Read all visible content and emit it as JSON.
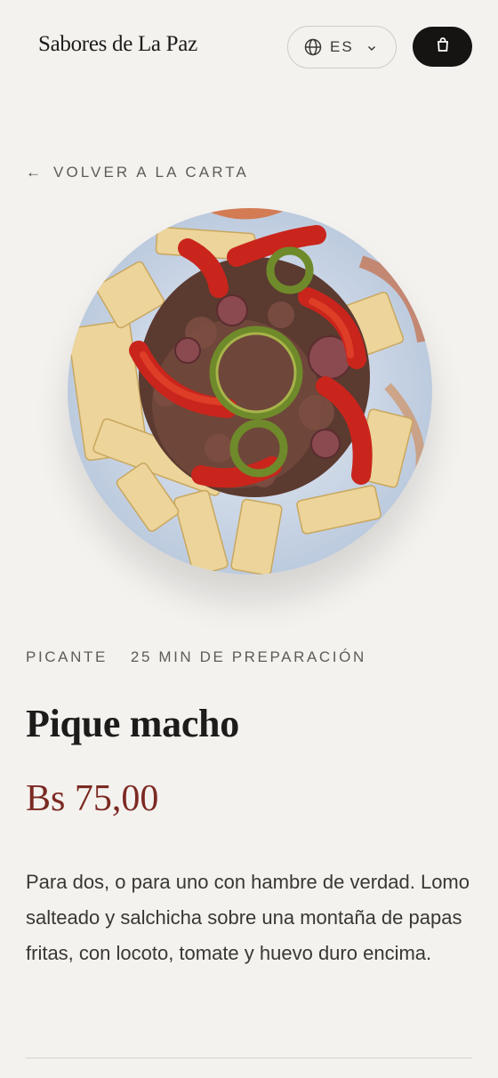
{
  "header": {
    "brand": "Sabores de La Paz",
    "language": {
      "code": "ES",
      "icon": "globe-icon",
      "chevron_icon": "chevron-down-icon"
    },
    "cart_icon": "shopping-bag-icon"
  },
  "back_link": {
    "arrow": "←",
    "label": "VOLVER A LA CARTA"
  },
  "dish": {
    "image_alt": "Pique macho",
    "tags": [
      "PICANTE",
      "25 MIN DE PREPARACIÓN"
    ],
    "name": "Pique macho",
    "price": "Bs 75,00",
    "description": "Para dos, o para uno con hambre de verdad. Lomo salteado y salchicha sobre una montaña de papas fritas, con locoto, tomate y huevo duro encima."
  },
  "colors": {
    "background": "#f4f2ef",
    "price": "#7b2a22",
    "cart_button": "#151412"
  }
}
